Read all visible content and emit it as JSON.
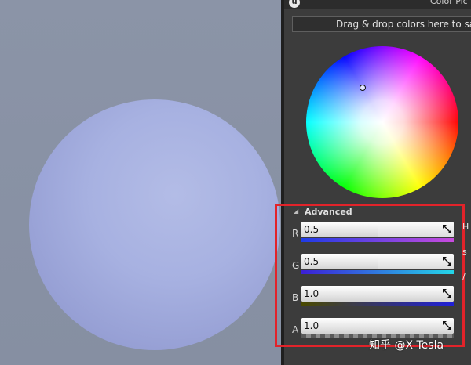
{
  "panel": {
    "title": "Color Pic",
    "logo_glyph": "u",
    "drop_zone_text": "Drag & drop colors here to save"
  },
  "advanced": {
    "label": "Advanced",
    "arrow_icon": "triangle-right-icon"
  },
  "channels": [
    {
      "label": "R",
      "value": "0.5",
      "fraction": 0.5
    },
    {
      "label": "G",
      "value": "0.5",
      "fraction": 0.5
    },
    {
      "label": "B",
      "value": "1.0",
      "fraction": 1.0
    },
    {
      "label": "A",
      "value": "1.0",
      "fraction": 1.0
    }
  ],
  "edge_glyphs": "H\n\ns\n\n/",
  "watermark": "知乎 @X Tesla",
  "colors": {
    "sphere": "#a7b1e1",
    "panel_bg": "#3c3c3c",
    "highlight_outline": "#e2232a"
  }
}
